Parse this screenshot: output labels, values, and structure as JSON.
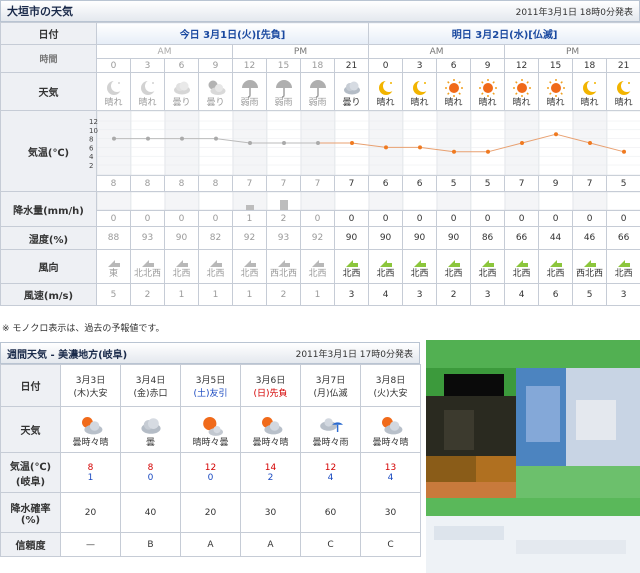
{
  "hourly": {
    "title": "大垣市の天気",
    "issued": "2011年3月1日 18時0分発表",
    "label_date": "日付",
    "label_time": "時間",
    "label_weather": "天気",
    "label_temp": "気温(℃)",
    "label_precip": "降水量(mm/h)",
    "label_humidity": "湿度(%)",
    "label_wind_dir": "風向",
    "label_wind_speed": "風速(m/s)",
    "today_header": "今日 3月1日(火)[先負]",
    "tomorrow_header": "明日 3月2日(水)[仏滅]",
    "am": "AM",
    "pm": "PM",
    "temp_axis": [
      "12",
      "10",
      "8",
      "6",
      "4",
      "2"
    ],
    "cols": [
      {
        "time": "0",
        "weather": "晴れ",
        "icon": "moon",
        "temp": "8",
        "precip": "0",
        "humidity": "88",
        "wind_dir": "東",
        "wind_speed": "5",
        "past": true,
        "temp_v": 8
      },
      {
        "time": "3",
        "weather": "晴れ",
        "icon": "moon",
        "temp": "8",
        "precip": "0",
        "humidity": "93",
        "wind_dir": "北北西",
        "wind_speed": "2",
        "past": true,
        "temp_v": 8
      },
      {
        "time": "6",
        "weather": "曇り",
        "icon": "cloud",
        "temp": "8",
        "precip": "0",
        "humidity": "90",
        "wind_dir": "北西",
        "wind_speed": "1",
        "past": true,
        "temp_v": 8
      },
      {
        "time": "9",
        "weather": "曇り",
        "icon": "cloud-sun",
        "temp": "8",
        "precip": "0",
        "humidity": "82",
        "wind_dir": "北西",
        "wind_speed": "1",
        "past": true,
        "temp_v": 8
      },
      {
        "time": "12",
        "weather": "弱雨",
        "icon": "umbrella",
        "temp": "7",
        "precip": "1",
        "humidity": "92",
        "wind_dir": "北西",
        "wind_speed": "1",
        "past": true,
        "temp_v": 7
      },
      {
        "time": "15",
        "weather": "弱雨",
        "icon": "umbrella",
        "temp": "7",
        "precip": "2",
        "humidity": "93",
        "wind_dir": "西北西",
        "wind_speed": "2",
        "past": true,
        "temp_v": 7
      },
      {
        "time": "18",
        "weather": "弱雨",
        "icon": "umbrella",
        "temp": "7",
        "precip": "0",
        "humidity": "92",
        "wind_dir": "北西",
        "wind_speed": "1",
        "past": true,
        "temp_v": 7
      },
      {
        "time": "21",
        "weather": "曇り",
        "icon": "cloud",
        "temp": "7",
        "precip": "0",
        "humidity": "90",
        "wind_dir": "北西",
        "wind_speed": "3",
        "past": false,
        "temp_v": 7
      },
      {
        "time": "0",
        "weather": "晴れ",
        "icon": "moon",
        "temp": "6",
        "precip": "0",
        "humidity": "90",
        "wind_dir": "北西",
        "wind_speed": "4",
        "past": false,
        "temp_v": 6
      },
      {
        "time": "3",
        "weather": "晴れ",
        "icon": "moon",
        "temp": "6",
        "precip": "0",
        "humidity": "90",
        "wind_dir": "北西",
        "wind_speed": "3",
        "past": false,
        "temp_v": 6
      },
      {
        "time": "6",
        "weather": "晴れ",
        "icon": "sun",
        "temp": "5",
        "precip": "0",
        "humidity": "90",
        "wind_dir": "北西",
        "wind_speed": "2",
        "past": false,
        "temp_v": 5
      },
      {
        "time": "9",
        "weather": "晴れ",
        "icon": "sun",
        "temp": "5",
        "precip": "0",
        "humidity": "86",
        "wind_dir": "北西",
        "wind_speed": "3",
        "past": false,
        "temp_v": 5
      },
      {
        "time": "12",
        "weather": "晴れ",
        "icon": "sun",
        "temp": "7",
        "precip": "0",
        "humidity": "66",
        "wind_dir": "北西",
        "wind_speed": "4",
        "past": false,
        "temp_v": 7
      },
      {
        "time": "15",
        "weather": "晴れ",
        "icon": "sun",
        "temp": "9",
        "precip": "0",
        "humidity": "44",
        "wind_dir": "北西",
        "wind_speed": "6",
        "past": false,
        "temp_v": 9
      },
      {
        "time": "18",
        "weather": "晴れ",
        "icon": "moon",
        "temp": "7",
        "precip": "0",
        "humidity": "46",
        "wind_dir": "西北西",
        "wind_speed": "5",
        "past": false,
        "temp_v": 7
      },
      {
        "time": "21",
        "weather": "晴れ",
        "icon": "moon",
        "temp": "5",
        "precip": "0",
        "humidity": "66",
        "wind_dir": "北西",
        "wind_speed": "3",
        "past": false,
        "temp_v": 5
      }
    ],
    "note": "※ モノクロ表示は、過去の予報値です。"
  },
  "weekly": {
    "title": "週間天気 - 美濃地方(岐阜)",
    "issued": "2011年3月1日 17時0分発表",
    "label_date": "日付",
    "label_weather": "天気",
    "label_temp": "気温(℃)",
    "label_temp_sub": "(岐阜)",
    "label_precip": "降水確率",
    "label_precip_sub": "(%)",
    "label_reliability": "信頼度",
    "days": [
      {
        "date": "3月3日",
        "dow": "(木)大安",
        "dow_color": "#333333",
        "weather": "曇時々晴",
        "icon": "cloud-sun",
        "high": "8",
        "low": "1",
        "precip": "20",
        "rel": "—"
      },
      {
        "date": "3月4日",
        "dow": "(金)赤口",
        "dow_color": "#333333",
        "weather": "曇",
        "icon": "cloud",
        "high": "8",
        "low": "0",
        "precip": "40",
        "rel": "B"
      },
      {
        "date": "3月5日",
        "dow": "(土)友引",
        "dow_color": "#1a49c0",
        "weather": "晴時々曇",
        "icon": "sun-cloud",
        "high": "12",
        "low": "0",
        "precip": "20",
        "rel": "A"
      },
      {
        "date": "3月6日",
        "dow": "(日)先負",
        "dow_color": "#d40000",
        "weather": "曇時々晴",
        "icon": "cloud-sun",
        "high": "14",
        "low": "2",
        "precip": "30",
        "rel": "A"
      },
      {
        "date": "3月7日",
        "dow": "(月)仏滅",
        "dow_color": "#333333",
        "weather": "曇時々雨",
        "icon": "cloud-rain",
        "high": "12",
        "low": "4",
        "precip": "60",
        "rel": "C"
      },
      {
        "date": "3月8日",
        "dow": "(火)大安",
        "dow_color": "#333333",
        "weather": "曇時々晴",
        "icon": "cloud-sun",
        "high": "13",
        "low": "4",
        "precip": "30",
        "rel": "C"
      }
    ]
  }
}
